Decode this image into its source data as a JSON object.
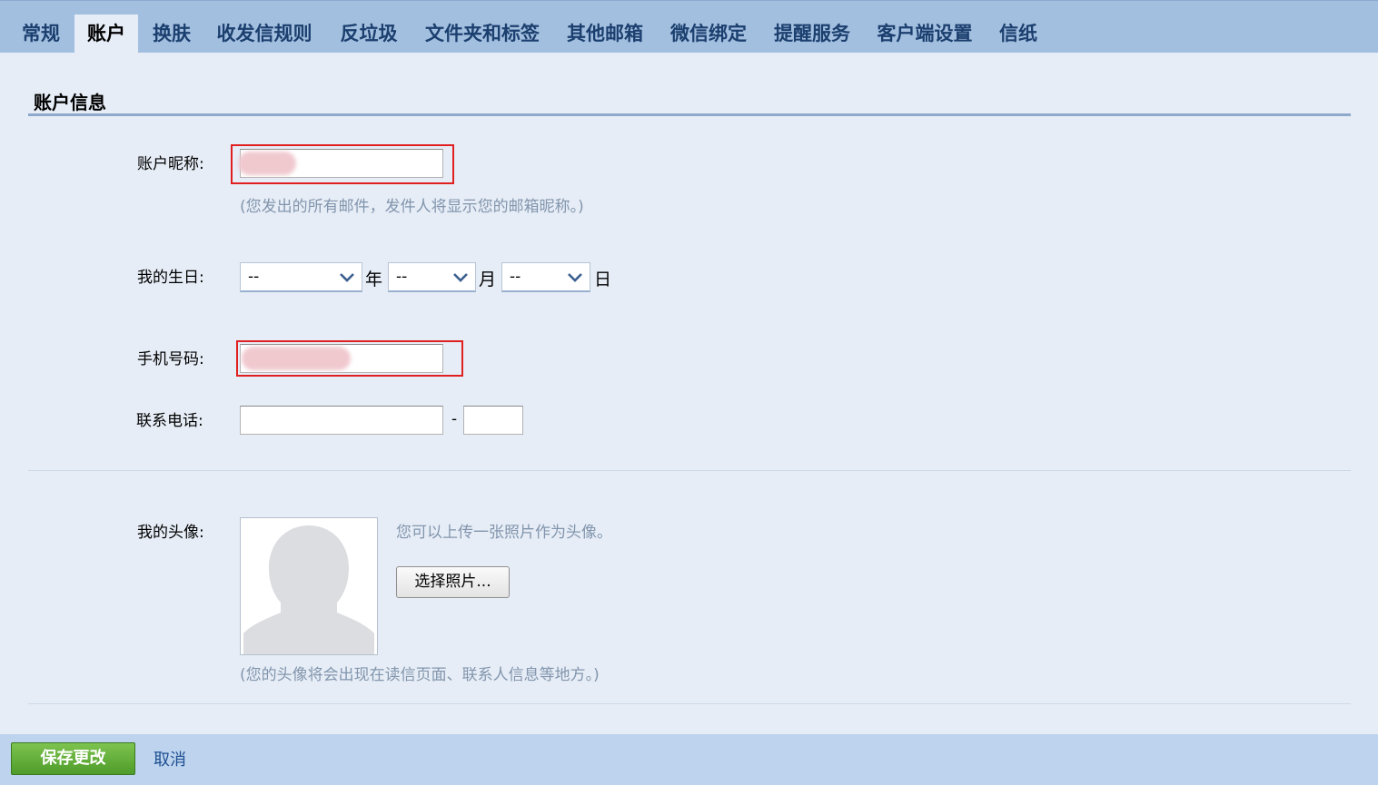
{
  "tabs": [
    {
      "label": "常规",
      "active": false
    },
    {
      "label": "账户",
      "active": true
    },
    {
      "label": "换肤",
      "active": false
    },
    {
      "label": "收发信规则",
      "active": false
    },
    {
      "label": "反垃圾",
      "active": false
    },
    {
      "label": "文件夹和标签",
      "active": false
    },
    {
      "label": "其他邮箱",
      "active": false
    },
    {
      "label": "微信绑定",
      "active": false
    },
    {
      "label": "提醒服务",
      "active": false
    },
    {
      "label": "客户端设置",
      "active": false
    },
    {
      "label": "信纸",
      "active": false
    }
  ],
  "section": {
    "title": "账户信息"
  },
  "nickname": {
    "label": "账户昵称:",
    "value": "",
    "hint": "(您发出的所有邮件，发件人将显示您的邮箱昵称。)"
  },
  "birthday": {
    "label": "我的生日:",
    "year_value": "--",
    "year_unit": "年",
    "month_value": "--",
    "month_unit": "月",
    "day_value": "--",
    "day_unit": "日"
  },
  "mobile": {
    "label": "手机号码:",
    "value": ""
  },
  "phone": {
    "label": "联系电话:",
    "main_value": "",
    "dash": "-",
    "ext_value": ""
  },
  "avatar": {
    "label": "我的头像:",
    "desc": "您可以上传一张照片作为头像。",
    "choose_button": "选择照片...",
    "hint": "(您的头像将会出现在读信页面、联系人信息等地方。)"
  },
  "footer": {
    "save_button": "保存更改",
    "cancel_link": "取消"
  },
  "colors": {
    "tab_bar": "#a3bfe0",
    "content_bg": "#e6edf6",
    "highlight_border": "#e02020",
    "save_button": "#5fa837",
    "hint_text": "#8295ad"
  }
}
